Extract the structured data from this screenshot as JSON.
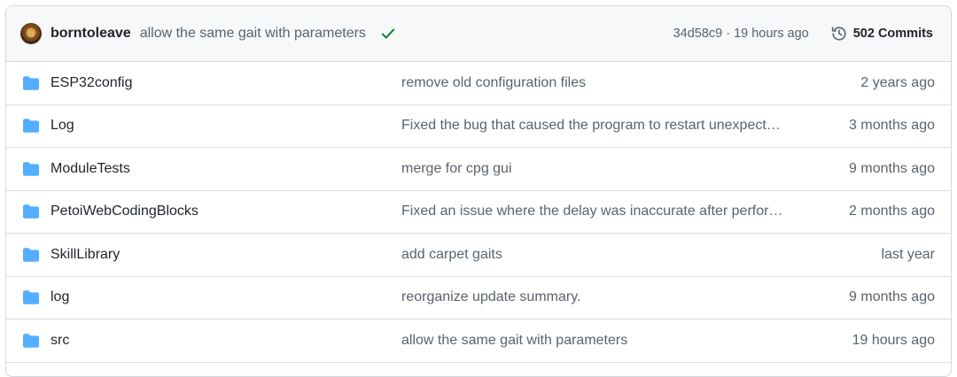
{
  "header": {
    "author": "borntoleave",
    "message": "allow the same gait with parameters",
    "status": "success",
    "meta": "34d58c9 · 19 hours ago",
    "commits_label": "502 Commits"
  },
  "icons": {
    "avatar": "user-avatar",
    "status": "check-icon",
    "history": "history-icon",
    "entry": "folder-icon"
  },
  "colors": {
    "folder": "#54aeff",
    "check": "#1a7f37",
    "muted_text": "#59636e"
  },
  "files": [
    {
      "name": "ESP32config",
      "message": "remove old configuration files",
      "date": "2 years ago"
    },
    {
      "name": "Log",
      "message": "Fixed the bug that caused the program to restart unexpect…",
      "date": "3 months ago"
    },
    {
      "name": "ModuleTests",
      "message": "merge for cpg gui",
      "date": "9 months ago"
    },
    {
      "name": "PetoiWebCodingBlocks",
      "message": "Fixed an issue where the delay was inaccurate after perfor…",
      "date": "2 months ago"
    },
    {
      "name": "SkillLibrary",
      "message": "add carpet gaits",
      "date": "last year"
    },
    {
      "name": "log",
      "message": "reorganize update summary.",
      "date": "9 months ago"
    },
    {
      "name": "src",
      "message": "allow the same gait with parameters",
      "date": "19 hours ago"
    }
  ]
}
